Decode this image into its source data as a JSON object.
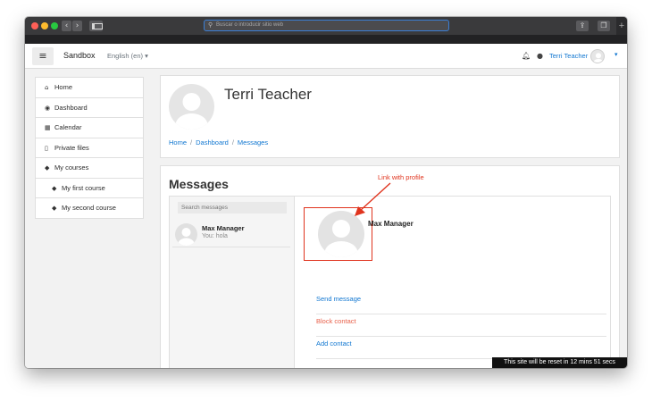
{
  "browser": {
    "url_placeholder": "Buscar o introducir sitio web",
    "back_icon": "‹",
    "forward_icon": "›",
    "share_icon": "⇪",
    "tabs_icon": "❐",
    "new_tab_icon": "+"
  },
  "navbar": {
    "brand": "Sandbox",
    "language": "English (en) ▾",
    "user_name": "Terri Teacher",
    "menu_icon": "≡",
    "caret": "▾"
  },
  "sidebar": {
    "items": [
      {
        "icon": "⌂",
        "label": "Home"
      },
      {
        "icon": "◉",
        "label": "Dashboard"
      },
      {
        "icon": "▦",
        "label": "Calendar"
      },
      {
        "icon": "▯",
        "label": "Private files"
      },
      {
        "icon": "◆",
        "label": "My courses"
      },
      {
        "icon": "◆",
        "label": "My first course"
      },
      {
        "icon": "◆",
        "label": "My second course"
      }
    ]
  },
  "header": {
    "title": "Terri Teacher",
    "breadcrumb": [
      "Home",
      "Dashboard",
      "Messages"
    ],
    "separator": "/"
  },
  "messages": {
    "title": "Messages",
    "search_placeholder": "Search messages",
    "contact": {
      "name": "Max Manager",
      "preview": "You: hola"
    },
    "profile_name": "Max Manager",
    "actions": {
      "send": "Send message",
      "block": "Block contact",
      "add": "Add contact"
    }
  },
  "annotation": {
    "text": "Link with profile",
    "color": "#e0341e"
  },
  "footer": {
    "reset_text": "This site will be reset in 12 mins 51 secs"
  },
  "colors": {
    "link": "#1177d1",
    "danger": "#e8604a",
    "annotation": "#e0341e"
  }
}
